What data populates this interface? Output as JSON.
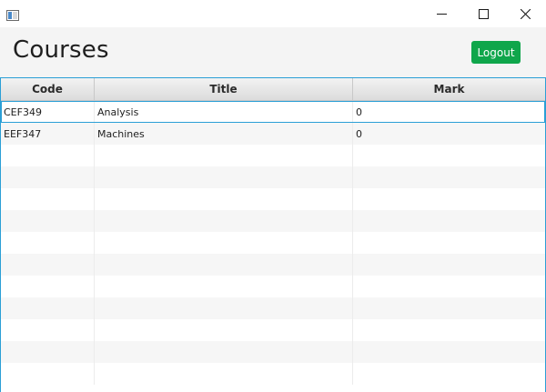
{
  "window": {
    "controls": {
      "minimize": "minimize-icon",
      "maximize": "maximize-icon",
      "close": "close-icon"
    }
  },
  "header": {
    "title": "Courses",
    "logout_label": "Logout"
  },
  "colors": {
    "accent": "#0fa64b",
    "focus": "#2b9fd6"
  },
  "table": {
    "columns": [
      "Code",
      "Title",
      "Mark"
    ],
    "rows": [
      {
        "code": "CEF349",
        "title": "Analysis",
        "mark": "0"
      },
      {
        "code": "EEF347",
        "title": "Machines",
        "mark": "0"
      }
    ],
    "selected_row": 0
  }
}
